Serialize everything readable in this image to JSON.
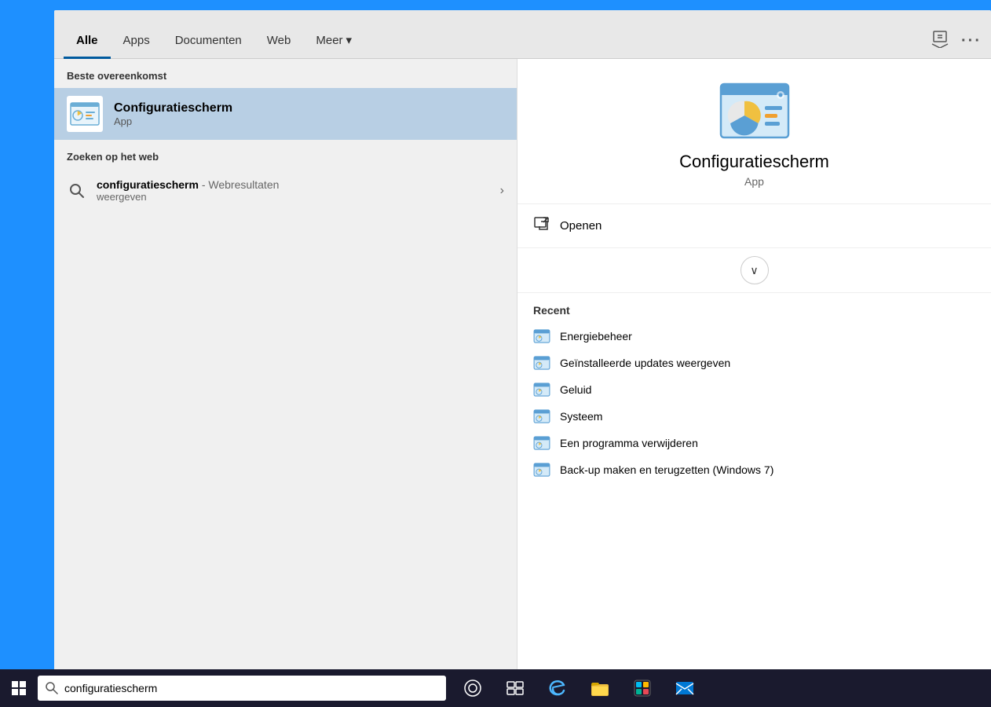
{
  "tabs": {
    "items": [
      {
        "label": "Alle",
        "active": true
      },
      {
        "label": "Apps",
        "active": false
      },
      {
        "label": "Documenten",
        "active": false
      },
      {
        "label": "Web",
        "active": false
      },
      {
        "label": "Meer",
        "active": false
      }
    ]
  },
  "header": {
    "user_icon": "👤",
    "more_icon": "···"
  },
  "left_panel": {
    "best_match_label": "Beste overeenkomst",
    "best_match_name": "Configuratiescherm",
    "best_match_type": "App",
    "web_search_label": "Zoeken op het web",
    "web_search_query": "configuratiescherm",
    "web_search_suffix": " - Webresultaten",
    "web_search_line2": "weergeven"
  },
  "right_panel": {
    "app_name": "Configuratiescherm",
    "app_type": "App",
    "open_label": "Openen",
    "recent_label": "Recent",
    "recent_items": [
      {
        "label": "Energiebeheer"
      },
      {
        "label": "Geïnstalleerde updates weergeven"
      },
      {
        "label": "Geluid"
      },
      {
        "label": "Systeem"
      },
      {
        "label": "Een programma verwijderen"
      },
      {
        "label": "Back-up maken en terugzetten (Windows 7)"
      }
    ]
  },
  "taskbar": {
    "search_text": "configuratiescherm",
    "start_label": "Start"
  }
}
